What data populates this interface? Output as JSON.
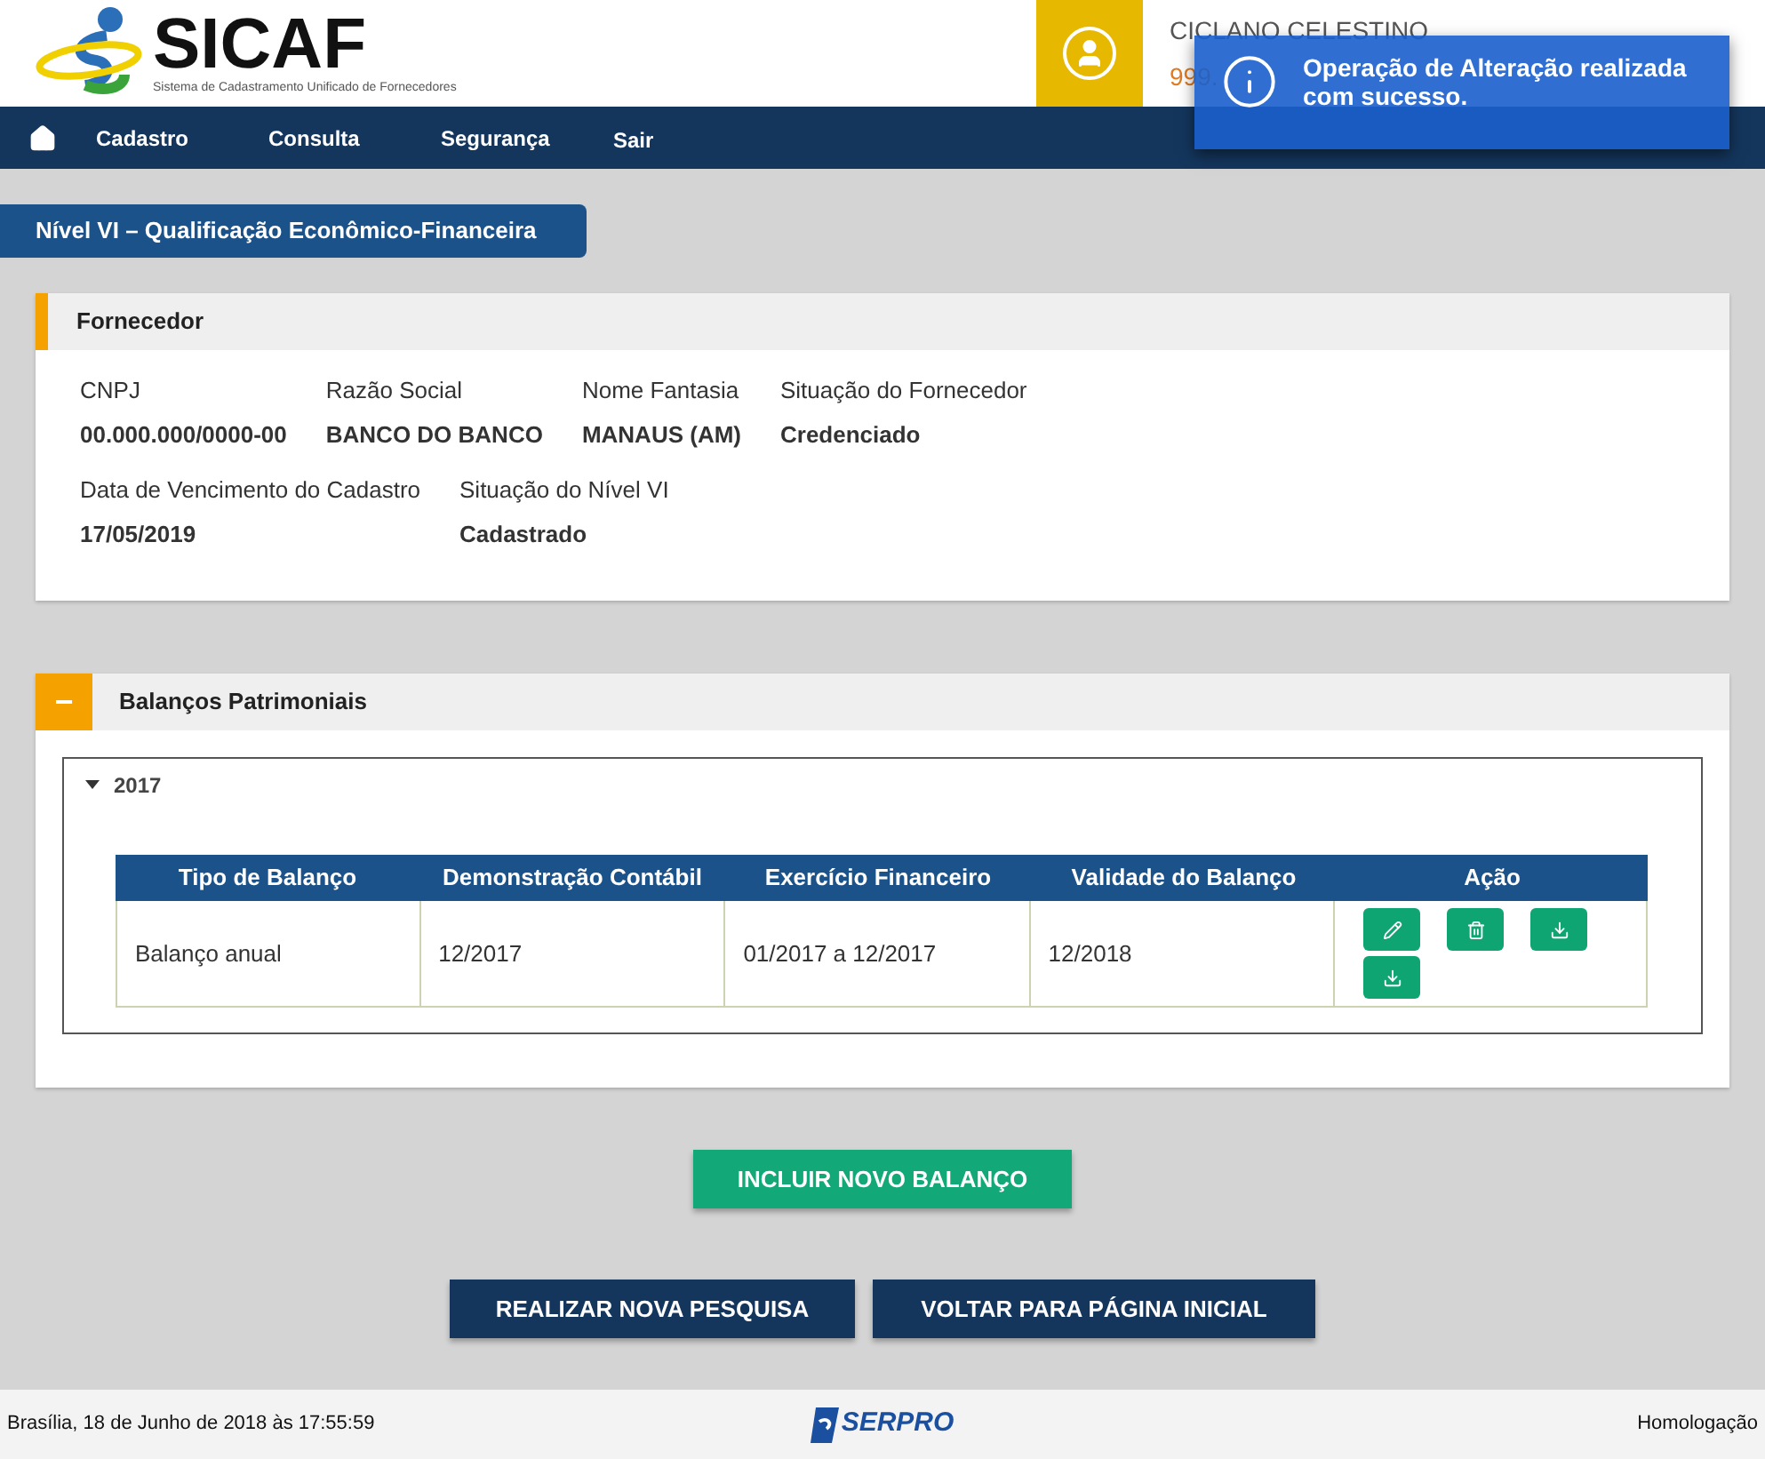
{
  "header": {
    "logo_title": "SICAF",
    "logo_subtitle": "Sistema de Cadastramento Unificado de Fornecedores",
    "user_name": "CICLANO CELESTINO",
    "user_id": "999."
  },
  "nav": [
    "Cadastro",
    "Consulta",
    "Segurança",
    "Sair"
  ],
  "toast": {
    "message": "Operação de Alteração realizada com sucesso."
  },
  "page_title": "Nível VI – Qualificação Econômico-Financeira",
  "fornecedor": {
    "title": "Fornecedor",
    "rows": [
      [
        {
          "label": "CNPJ",
          "value": "00.000.000/0000-00"
        },
        {
          "label": "Razão Social",
          "value": "BANCO DO BANCO"
        },
        {
          "label": "Nome Fantasia",
          "value": "MANAUS (AM)"
        },
        {
          "label": "Situação do Fornecedor",
          "value": "Credenciado"
        }
      ],
      [
        {
          "label": "Data de Vencimento do Cadastro",
          "value": "17/05/2019"
        },
        {
          "label": "Situação do Nível VI",
          "value": "Cadastrado"
        }
      ]
    ]
  },
  "balancos": {
    "title": "Balanços Patrimoniais",
    "toggle": "−",
    "expanded": true,
    "groups": [
      {
        "year": "2017",
        "expanded": true,
        "table": {
          "columns": [
            "Tipo de Balanço",
            "Demonstração Contábil",
            "Exercício Financeiro",
            "Validade do Balanço",
            "Ação"
          ],
          "rows": [
            {
              "cells": [
                "Balanço anual",
                "12/2017",
                "01/2017 a 12/2017",
                "12/2018"
              ],
              "actions": [
                {
                  "kind": "edit"
                },
                {
                  "kind": "delete"
                },
                {
                  "kind": "download"
                },
                {
                  "kind": "download"
                }
              ]
            }
          ]
        }
      }
    ]
  },
  "buttons": {
    "add": "INCLUIR NOVO BALANÇO",
    "search": "REALIZAR NOVA PESQUISA",
    "home": "VOLTAR PARA PÁGINA INICIAL"
  },
  "footer": {
    "datetime": "Brasília, 18 de Junho de 2018 às 17:55:59",
    "logo": "SERPRO",
    "environment": "Homologação"
  }
}
